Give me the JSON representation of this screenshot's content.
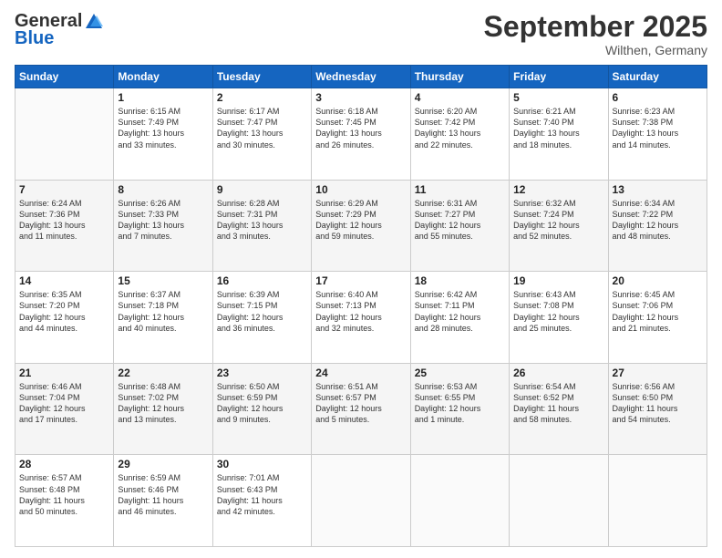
{
  "header": {
    "logo_general": "General",
    "logo_blue": "Blue",
    "month_title": "September 2025",
    "subtitle": "Wilthen, Germany"
  },
  "days_of_week": [
    "Sunday",
    "Monday",
    "Tuesday",
    "Wednesday",
    "Thursday",
    "Friday",
    "Saturday"
  ],
  "weeks": [
    [
      {
        "day": "",
        "info": ""
      },
      {
        "day": "1",
        "info": "Sunrise: 6:15 AM\nSunset: 7:49 PM\nDaylight: 13 hours\nand 33 minutes."
      },
      {
        "day": "2",
        "info": "Sunrise: 6:17 AM\nSunset: 7:47 PM\nDaylight: 13 hours\nand 30 minutes."
      },
      {
        "day": "3",
        "info": "Sunrise: 6:18 AM\nSunset: 7:45 PM\nDaylight: 13 hours\nand 26 minutes."
      },
      {
        "day": "4",
        "info": "Sunrise: 6:20 AM\nSunset: 7:42 PM\nDaylight: 13 hours\nand 22 minutes."
      },
      {
        "day": "5",
        "info": "Sunrise: 6:21 AM\nSunset: 7:40 PM\nDaylight: 13 hours\nand 18 minutes."
      },
      {
        "day": "6",
        "info": "Sunrise: 6:23 AM\nSunset: 7:38 PM\nDaylight: 13 hours\nand 14 minutes."
      }
    ],
    [
      {
        "day": "7",
        "info": "Sunrise: 6:24 AM\nSunset: 7:36 PM\nDaylight: 13 hours\nand 11 minutes."
      },
      {
        "day": "8",
        "info": "Sunrise: 6:26 AM\nSunset: 7:33 PM\nDaylight: 13 hours\nand 7 minutes."
      },
      {
        "day": "9",
        "info": "Sunrise: 6:28 AM\nSunset: 7:31 PM\nDaylight: 13 hours\nand 3 minutes."
      },
      {
        "day": "10",
        "info": "Sunrise: 6:29 AM\nSunset: 7:29 PM\nDaylight: 12 hours\nand 59 minutes."
      },
      {
        "day": "11",
        "info": "Sunrise: 6:31 AM\nSunset: 7:27 PM\nDaylight: 12 hours\nand 55 minutes."
      },
      {
        "day": "12",
        "info": "Sunrise: 6:32 AM\nSunset: 7:24 PM\nDaylight: 12 hours\nand 52 minutes."
      },
      {
        "day": "13",
        "info": "Sunrise: 6:34 AM\nSunset: 7:22 PM\nDaylight: 12 hours\nand 48 minutes."
      }
    ],
    [
      {
        "day": "14",
        "info": "Sunrise: 6:35 AM\nSunset: 7:20 PM\nDaylight: 12 hours\nand 44 minutes."
      },
      {
        "day": "15",
        "info": "Sunrise: 6:37 AM\nSunset: 7:18 PM\nDaylight: 12 hours\nand 40 minutes."
      },
      {
        "day": "16",
        "info": "Sunrise: 6:39 AM\nSunset: 7:15 PM\nDaylight: 12 hours\nand 36 minutes."
      },
      {
        "day": "17",
        "info": "Sunrise: 6:40 AM\nSunset: 7:13 PM\nDaylight: 12 hours\nand 32 minutes."
      },
      {
        "day": "18",
        "info": "Sunrise: 6:42 AM\nSunset: 7:11 PM\nDaylight: 12 hours\nand 28 minutes."
      },
      {
        "day": "19",
        "info": "Sunrise: 6:43 AM\nSunset: 7:08 PM\nDaylight: 12 hours\nand 25 minutes."
      },
      {
        "day": "20",
        "info": "Sunrise: 6:45 AM\nSunset: 7:06 PM\nDaylight: 12 hours\nand 21 minutes."
      }
    ],
    [
      {
        "day": "21",
        "info": "Sunrise: 6:46 AM\nSunset: 7:04 PM\nDaylight: 12 hours\nand 17 minutes."
      },
      {
        "day": "22",
        "info": "Sunrise: 6:48 AM\nSunset: 7:02 PM\nDaylight: 12 hours\nand 13 minutes."
      },
      {
        "day": "23",
        "info": "Sunrise: 6:50 AM\nSunset: 6:59 PM\nDaylight: 12 hours\nand 9 minutes."
      },
      {
        "day": "24",
        "info": "Sunrise: 6:51 AM\nSunset: 6:57 PM\nDaylight: 12 hours\nand 5 minutes."
      },
      {
        "day": "25",
        "info": "Sunrise: 6:53 AM\nSunset: 6:55 PM\nDaylight: 12 hours\nand 1 minute."
      },
      {
        "day": "26",
        "info": "Sunrise: 6:54 AM\nSunset: 6:52 PM\nDaylight: 11 hours\nand 58 minutes."
      },
      {
        "day": "27",
        "info": "Sunrise: 6:56 AM\nSunset: 6:50 PM\nDaylight: 11 hours\nand 54 minutes."
      }
    ],
    [
      {
        "day": "28",
        "info": "Sunrise: 6:57 AM\nSunset: 6:48 PM\nDaylight: 11 hours\nand 50 minutes."
      },
      {
        "day": "29",
        "info": "Sunrise: 6:59 AM\nSunset: 6:46 PM\nDaylight: 11 hours\nand 46 minutes."
      },
      {
        "day": "30",
        "info": "Sunrise: 7:01 AM\nSunset: 6:43 PM\nDaylight: 11 hours\nand 42 minutes."
      },
      {
        "day": "",
        "info": ""
      },
      {
        "day": "",
        "info": ""
      },
      {
        "day": "",
        "info": ""
      },
      {
        "day": "",
        "info": ""
      }
    ]
  ]
}
